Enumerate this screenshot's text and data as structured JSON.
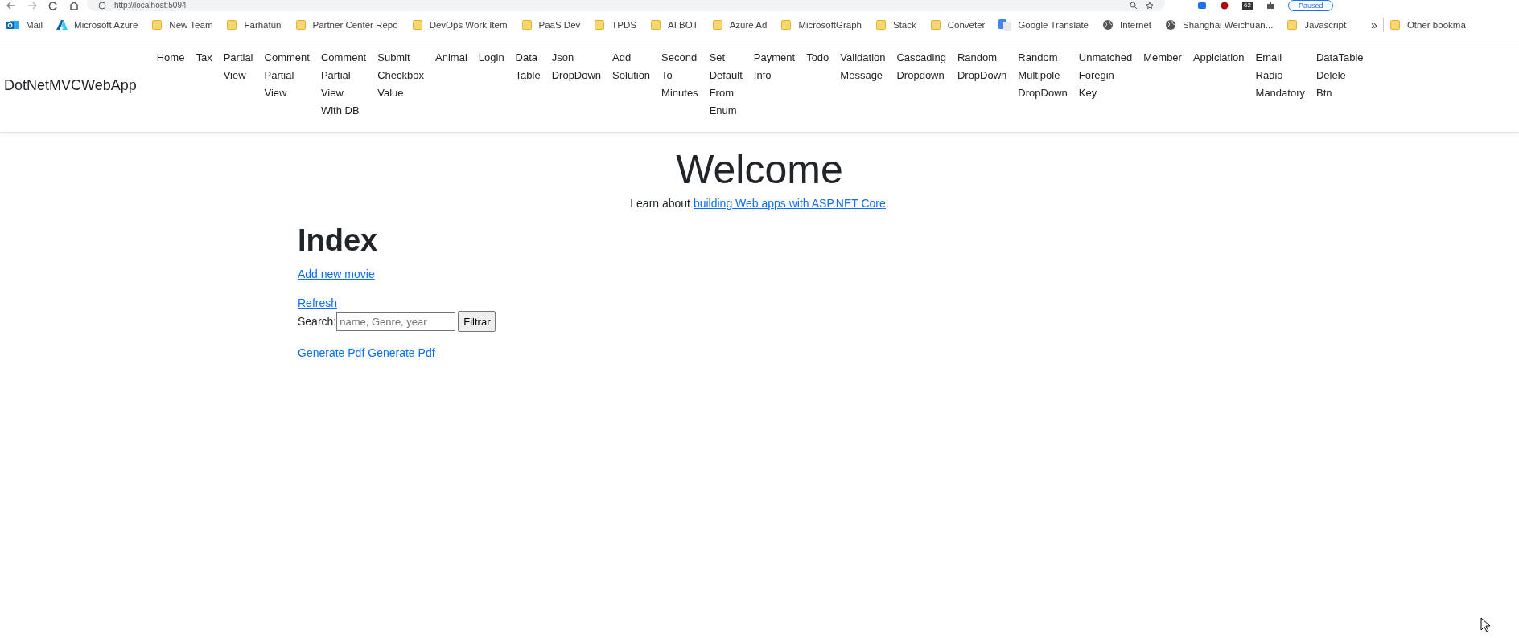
{
  "browser": {
    "address": "http://localhost:5094",
    "badge": "62",
    "profile": "Paused"
  },
  "bookmarks": [
    {
      "label": "Mail",
      "kind": "mail"
    },
    {
      "label": "Microsoft Azure",
      "kind": "azure"
    },
    {
      "label": "New Team",
      "kind": "folder"
    },
    {
      "label": "Farhatun",
      "kind": "folder"
    },
    {
      "label": "Partner Center Repo",
      "kind": "folder"
    },
    {
      "label": "DevOps Work Item",
      "kind": "folder"
    },
    {
      "label": "PaaS Dev",
      "kind": "folder"
    },
    {
      "label": "TPDS",
      "kind": "folder"
    },
    {
      "label": "AI BOT",
      "kind": "folder"
    },
    {
      "label": "Azure Ad",
      "kind": "folder"
    },
    {
      "label": "MicrosoftGraph",
      "kind": "folder"
    },
    {
      "label": "Stack",
      "kind": "folder"
    },
    {
      "label": "Conveter",
      "kind": "folder"
    },
    {
      "label": "Google Translate",
      "kind": "translate"
    },
    {
      "label": "Internet",
      "kind": "globe"
    },
    {
      "label": "Shanghai Weichuan...",
      "kind": "globe"
    },
    {
      "label": "Javascript",
      "kind": "folder"
    }
  ],
  "bookmarks_more": "»",
  "other_bookmarks": "Other bookma",
  "navbar": {
    "brand": "DotNetMVCWebApp",
    "items": [
      "Home",
      "Tax",
      "Partial View",
      "Comment Partial View",
      "Comment Partial View With DB",
      "Submit Checkbox Value",
      "Animal",
      "Login",
      "Data Table",
      "Json DropDown",
      "Add Solution",
      "Second To Minutes",
      "Set Default From Enum",
      "Payment Info",
      "Todo",
      "Validation Message",
      "Cascading Dropdown",
      "Random DropDown",
      "Random Multipole DropDown",
      "Unmatched Foregin Key",
      "Member",
      "Applciation",
      "Email Radio Mandatory",
      "DataTable Delele Btn"
    ]
  },
  "welcome": {
    "title": "Welcome",
    "intro": "Learn about ",
    "link": "building Web apps with ASP.NET Core",
    "end": "."
  },
  "index": {
    "title": "Index",
    "add_link": "Add new movie",
    "refresh_link": "Refresh",
    "search_label": "Search:",
    "search_placeholder": "name, Genre, year",
    "search_button": "Filtrar",
    "pdf_links": [
      "Generate Pdf",
      "Generate Pdf"
    ]
  }
}
